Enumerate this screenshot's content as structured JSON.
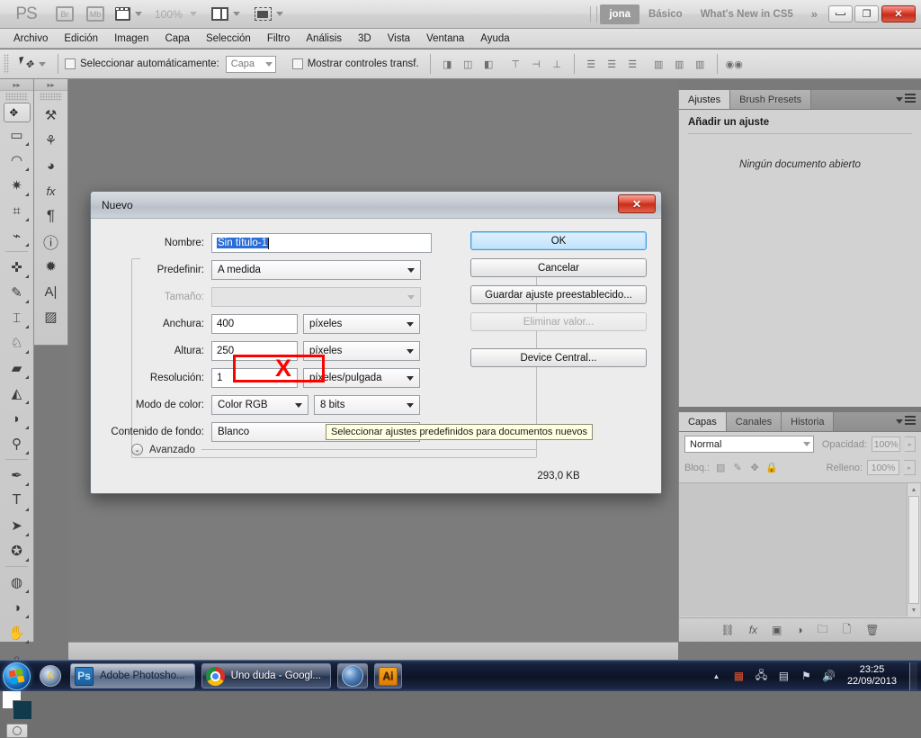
{
  "titlebar": {
    "logo": "PS",
    "buttons": [
      {
        "name": "bridge",
        "label": "Br"
      },
      {
        "name": "mini-bridge",
        "label": "Mb"
      },
      {
        "name": "view-extras",
        "label": ""
      },
      {
        "name": "zoom-level",
        "label": "100%"
      },
      {
        "name": "arrange-documents",
        "label": ""
      },
      {
        "name": "screen-mode",
        "label": ""
      }
    ],
    "zoom_level": "100%",
    "workspaces": [
      {
        "label": "jona",
        "active": true
      },
      {
        "label": "Básico",
        "active": false
      },
      {
        "label": "What's New in CS5",
        "active": false
      }
    ],
    "overflow": "»",
    "window_buttons": {
      "minimize": "—",
      "restore": "❐",
      "close": "✕"
    }
  },
  "menubar": {
    "items": [
      "Archivo",
      "Edición",
      "Imagen",
      "Capa",
      "Selección",
      "Filtro",
      "Análisis",
      "3D",
      "Vista",
      "Ventana",
      "Ayuda"
    ]
  },
  "optionsbar": {
    "tool": "move-tool",
    "auto_select_label": "Seleccionar automáticamente:",
    "auto_select_value": "Capa",
    "auto_select_checked": false,
    "transform_controls_label": "Mostrar controles transf.",
    "transform_controls_checked": false,
    "align_groups": [
      [
        "align-left-edges",
        "align-horizontal-centers",
        "align-right-edges"
      ],
      [
        "align-top-edges",
        "align-vertical-centers",
        "align-bottom-edges"
      ],
      [
        "distribute-top",
        "distribute-vertical-center",
        "distribute-bottom"
      ],
      [
        "distribute-left",
        "distribute-horizontal-center",
        "distribute-right"
      ],
      [
        "auto-align-layers"
      ]
    ]
  },
  "toolbox": {
    "column1": [
      {
        "name": "move-tool",
        "glyph": "✥",
        "selected": true,
        "has_submenu": false
      },
      {
        "name": "rectangular-marquee-tool",
        "glyph": "▭",
        "selected": false,
        "has_submenu": true
      },
      {
        "name": "lasso-tool",
        "glyph": "◯",
        "selected": false,
        "has_submenu": true
      },
      {
        "name": "quick-selection-tool",
        "glyph": "✳",
        "selected": false,
        "has_submenu": true
      },
      {
        "name": "crop-tool",
        "glyph": "⊹",
        "selected": false,
        "has_submenu": true
      },
      {
        "name": "eyedropper-tool",
        "glyph": "✒",
        "selected": false,
        "has_submenu": true
      },
      {
        "name": "spot-healing-brush-tool",
        "glyph": "✿",
        "selected": false,
        "has_submenu": true
      },
      {
        "name": "brush-tool",
        "glyph": "✎",
        "selected": false,
        "has_submenu": true
      },
      {
        "name": "clone-stamp-tool",
        "glyph": "⎙",
        "selected": false,
        "has_submenu": true
      },
      {
        "name": "history-brush-tool",
        "glyph": "✄",
        "selected": false,
        "has_submenu": true
      },
      {
        "name": "eraser-tool",
        "glyph": "▰",
        "selected": false,
        "has_submenu": true
      },
      {
        "name": "gradient-tool",
        "glyph": "◨",
        "selected": false,
        "has_submenu": true
      },
      {
        "name": "blur-tool",
        "glyph": "◔",
        "selected": false,
        "has_submenu": true
      },
      {
        "name": "dodge-tool",
        "glyph": "●",
        "selected": false,
        "has_submenu": true
      },
      {
        "name": "pen-tool",
        "glyph": "✐",
        "selected": false,
        "has_submenu": true
      },
      {
        "name": "horizontal-type-tool",
        "glyph": "T",
        "selected": false,
        "has_submenu": true
      },
      {
        "name": "path-selection-tool",
        "glyph": "➤",
        "selected": false,
        "has_submenu": true
      },
      {
        "name": "custom-shape-tool",
        "glyph": "✪",
        "selected": false,
        "has_submenu": true
      },
      {
        "name": "3d-object-rotate-tool",
        "glyph": "◍",
        "selected": false,
        "has_submenu": true
      },
      {
        "name": "3d-camera-rotate-tool",
        "glyph": "◑",
        "selected": false,
        "has_submenu": true
      },
      {
        "name": "hand-tool",
        "glyph": "✋",
        "selected": false,
        "has_submenu": true
      },
      {
        "name": "zoom-tool",
        "glyph": "🔍",
        "selected": false,
        "has_submenu": false
      }
    ],
    "column2": [
      {
        "name": "3d-material-drop-tool",
        "glyph": "⚒"
      },
      {
        "name": "brush-panel-tool",
        "glyph": "✇"
      },
      {
        "name": "color-panel-tool",
        "glyph": "🎨"
      },
      {
        "name": "styles-panel-tool",
        "glyph": "fx"
      },
      {
        "name": "paragraph-panel-tool",
        "glyph": "¶"
      },
      {
        "name": "info-panel-tool",
        "glyph": "ℹ"
      },
      {
        "name": "3d-panel-tool",
        "glyph": "✹"
      },
      {
        "name": "character-panel-tool",
        "glyph": "A"
      },
      {
        "name": "histogram-panel-tool",
        "glyph": "▨"
      }
    ],
    "foreground_color": "#ffffff",
    "background_color": "#123a4d",
    "quick_mask_label": "quick-mask-mode"
  },
  "panels": {
    "top_dock": {
      "tabs": [
        {
          "label": "Ajustes",
          "active": true
        },
        {
          "label": "Brush Presets",
          "active": false
        }
      ],
      "heading": "Añadir un ajuste",
      "empty_message": "Ningún documento abierto"
    },
    "bottom_dock": {
      "tabs": [
        {
          "label": "Capas",
          "active": true
        },
        {
          "label": "Canales",
          "active": false
        },
        {
          "label": "Historia",
          "active": false
        }
      ],
      "blend_mode": "Normal",
      "opacity_label": "Opacidad:",
      "opacity_value": "100%",
      "lock_label": "Bloq.:",
      "fill_label": "Relleno:",
      "fill_value": "100%",
      "lock_icons": [
        "lock-transparent-pixels-icon",
        "lock-image-pixels-icon",
        "lock-position-icon",
        "lock-all-icon"
      ],
      "footer_icons": [
        "link-layers-icon",
        "layer-style-fx-icon",
        "layer-mask-icon",
        "new-adjustment-layer-icon",
        "new-group-icon",
        "new-layer-icon",
        "delete-layer-icon"
      ]
    }
  },
  "dialog": {
    "title": "Nuevo",
    "close_label": "✕",
    "fields": {
      "name_label": "Nombre:",
      "name_value": "Sin título-1",
      "preset_label": "Predefinir:",
      "preset_value": "A medida",
      "size_label": "Tamaño:",
      "size_value": "",
      "width_label": "Anchura:",
      "width_value": "400",
      "width_unit": "píxeles",
      "height_label": "Altura:",
      "height_value": "250",
      "height_unit": "píxeles",
      "resolution_label": "Resolución:",
      "resolution_value": "1",
      "resolution_unit": "píxeles/pulgada",
      "color_mode_label": "Modo de color:",
      "color_mode_value": "Color RGB",
      "bit_depth_value": "8 bits",
      "background_label": "Contenido de fondo:",
      "background_value": "Blanco",
      "advanced_label": "Avanzado"
    },
    "buttons": [
      {
        "name": "ok-button",
        "label": "OK",
        "style": "primary",
        "disabled": false
      },
      {
        "name": "cancel-button",
        "label": "Cancelar",
        "style": "normal",
        "disabled": false
      },
      {
        "name": "save-preset-button",
        "label": "Guardar ajuste preestablecido...",
        "style": "normal",
        "disabled": false
      },
      {
        "name": "delete-preset-button",
        "label": "Eliminar valor...",
        "style": "normal",
        "disabled": true
      },
      {
        "name": "device-central-button",
        "label": "Device Central...",
        "style": "normal",
        "disabled": false
      }
    ],
    "image_size": "293,0 KB",
    "tooltip": "Seleccionar ajustes predefinidos para documentos nuevos",
    "annotation": {
      "mark": "X",
      "color": "#ff0000"
    }
  },
  "taskbar": {
    "start_label": "start-orb",
    "quick_launch": [
      "autocad-icon",
      "internet-explorer-icon"
    ],
    "tasks": [
      {
        "name": "task-photoshop",
        "label": "Adobe Photosho...",
        "icon": "Ps",
        "active": true
      },
      {
        "name": "task-chrome",
        "label": "Uno duda - Googl...",
        "icon": "chrome",
        "active": false
      },
      {
        "name": "task-explorer",
        "label": "",
        "icon": "globe",
        "active": false
      },
      {
        "name": "task-illustrator",
        "label": "",
        "icon": "Ai",
        "active": false
      }
    ],
    "tray_icons": [
      "show-hidden-icons-arrow",
      "avast-icon",
      "network-icon",
      "action-center-icon",
      "flag-icon",
      "volume-icon"
    ],
    "clock_time": "23:25",
    "clock_date": "22/09/2013"
  }
}
